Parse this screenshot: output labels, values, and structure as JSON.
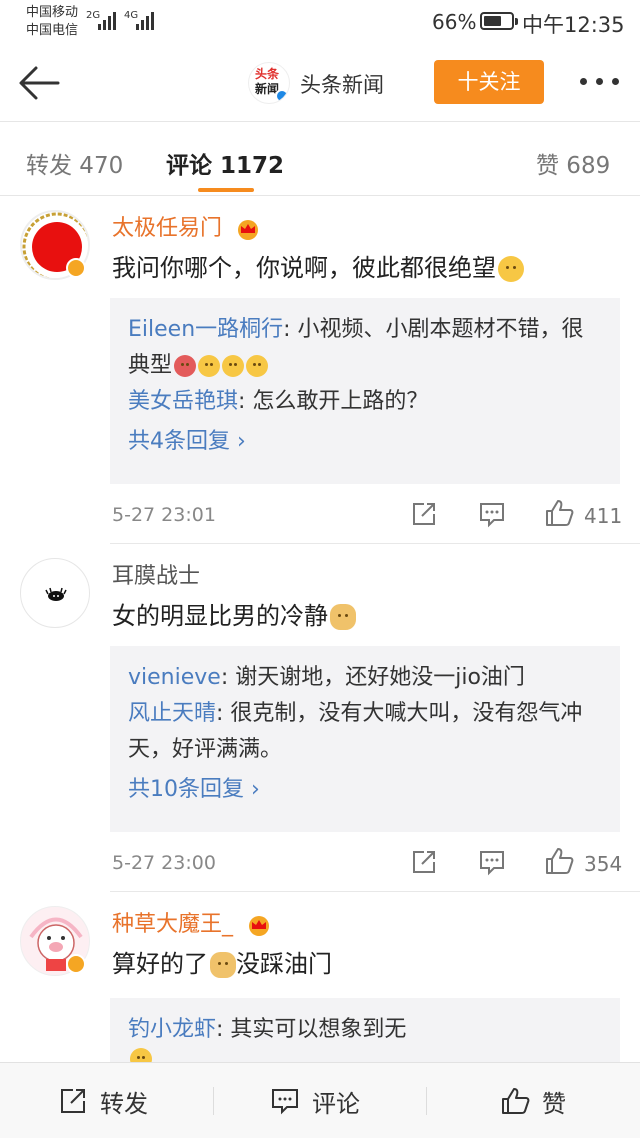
{
  "status_bar": {
    "carrier_1": "中国移动",
    "carrier_2": "中国电信",
    "network_1": "2G",
    "network_2": "4G",
    "battery_percent": "66%",
    "battery_level": 0.66,
    "time": "中午12:35"
  },
  "nav": {
    "logo_text_top": "头条",
    "logo_text_bottom": "新闻",
    "title": "头条新闻",
    "follow_label": "十关注"
  },
  "tabs": {
    "repost": "转发 470",
    "comments": "评论 1172",
    "likes": "赞 689"
  },
  "comments": [
    {
      "author": "太极任易门",
      "vip": true,
      "text": "我问你哪个，你说啊，彼此都很绝望",
      "replies": [
        {
          "who": "Eileen一路桐行",
          "text": ": 小视频、小剧本题材不错，很典型"
        },
        {
          "who": "美女岳艳琪",
          "text": ": 怎么敢开上路的？"
        }
      ],
      "more_replies": "共4条回复 ›",
      "time": "5-27 23:01",
      "likes": "411"
    },
    {
      "author": "耳膜战士",
      "vip": false,
      "text": "女的明显比男的冷静",
      "replies": [
        {
          "who": "vienieve",
          "text": ": 谢天谢地，还好她没一jio油门"
        },
        {
          "who": "风止天晴",
          "text": ": 很克制，没有大喊大叫，没有怨气冲天，好评满满。"
        }
      ],
      "more_replies": "共10条回复 ›",
      "time": "5-27 23:00",
      "likes": "354"
    },
    {
      "author": "种草大魔王_",
      "vip": true,
      "text_before": "算好的了",
      "text_after": "没踩油门",
      "replies": [
        {
          "who": "钓小龙虾",
          "text": ": 其实可以想象到无"
        }
      ]
    }
  ],
  "bottom_bar": {
    "repost": "转发",
    "comment": "评论",
    "like": "赞"
  }
}
